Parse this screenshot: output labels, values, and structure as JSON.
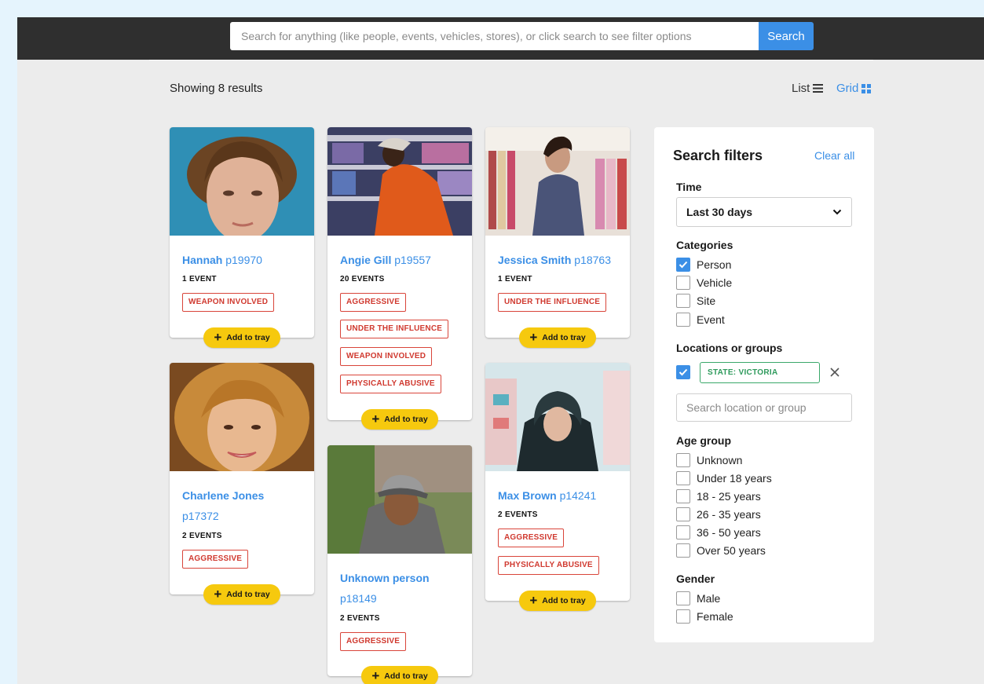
{
  "search": {
    "placeholder": "Search for anything (like people, events, vehicles, stores), or click search to see filter options",
    "button_label": "Search"
  },
  "results": {
    "count_label": "Showing 8 results",
    "view_list_label": "List",
    "view_grid_label": "Grid"
  },
  "cards": [
    {
      "name": "Hannah",
      "pid": "p19970",
      "events": "1 EVENT",
      "tags": [
        "WEAPON INVOLVED"
      ],
      "add_label": "Add to tray"
    },
    {
      "name": "Angie Gill",
      "pid": "p19557",
      "events": "20 EVENTS",
      "tags": [
        "AGGRESSIVE",
        "UNDER THE INFLUENCE",
        "WEAPON INVOLVED",
        "PHYSICALLY ABUSIVE"
      ],
      "add_label": "Add to tray"
    },
    {
      "name": "Jessica Smith",
      "pid": "p18763",
      "events": "1 EVENT",
      "tags": [
        "UNDER THE INFLUENCE"
      ],
      "add_label": "Add to tray"
    },
    {
      "name": "Charlene Jones",
      "pid": "p17372",
      "events": "2 EVENTS",
      "tags": [
        "AGGRESSIVE"
      ],
      "add_label": "Add to tray"
    },
    {
      "name": "Unknown person",
      "pid": "p18149",
      "events": "2 EVENTS",
      "tags": [
        "AGGRESSIVE"
      ],
      "add_label": "Add to tray"
    },
    {
      "name": "Max Brown",
      "pid": "p14241",
      "events": "2 EVENTS",
      "tags": [
        "AGGRESSIVE",
        "PHYSICALLY ABUSIVE"
      ],
      "add_label": "Add to tray"
    }
  ],
  "filters": {
    "title": "Search filters",
    "clear_label": "Clear all",
    "time": {
      "label": "Time",
      "selected": "Last 30 days"
    },
    "categories": {
      "label": "Categories",
      "options": [
        {
          "label": "Person",
          "checked": true
        },
        {
          "label": "Vehicle",
          "checked": false
        },
        {
          "label": "Site",
          "checked": false
        },
        {
          "label": "Event",
          "checked": false
        }
      ]
    },
    "locations": {
      "label": "Locations or groups",
      "chip": "STATE: VICTORIA",
      "chip_checked": true,
      "placeholder": "Search location or group"
    },
    "age": {
      "label": "Age group",
      "options": [
        {
          "label": "Unknown",
          "checked": false
        },
        {
          "label": "Under 18 years",
          "checked": false
        },
        {
          "label": "18 - 25 years",
          "checked": false
        },
        {
          "label": "26 - 35 years",
          "checked": false
        },
        {
          "label": "36 - 50 years",
          "checked": false
        },
        {
          "label": "Over 50 years",
          "checked": false
        }
      ]
    },
    "gender": {
      "label": "Gender",
      "options": [
        {
          "label": "Male",
          "checked": false
        },
        {
          "label": "Female",
          "checked": false
        }
      ]
    }
  },
  "colors": {
    "accent": "#3b8fe6",
    "tag_red": "#d9453a",
    "tray_yellow": "#f6c90e",
    "chip_green": "#3aa86a",
    "topbar": "#2f2f2f"
  }
}
